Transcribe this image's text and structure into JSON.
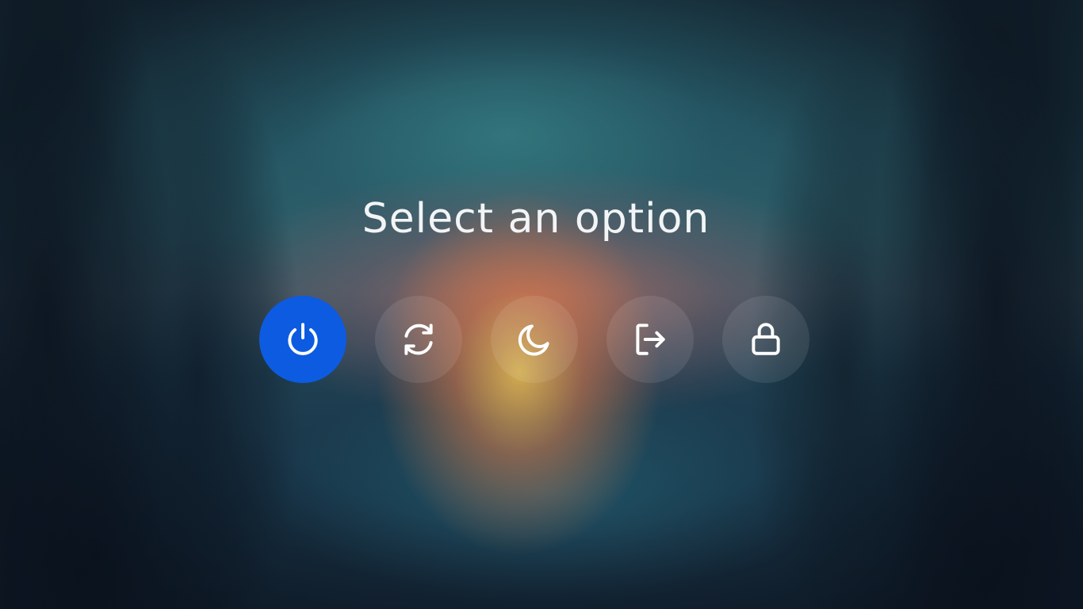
{
  "dialog": {
    "title": "Select an option",
    "accent_color": "#0d5be0"
  },
  "options": [
    {
      "id": "power",
      "icon": "power-icon",
      "selected": true
    },
    {
      "id": "restart",
      "icon": "restart-icon",
      "selected": false
    },
    {
      "id": "sleep",
      "icon": "moon-icon",
      "selected": false
    },
    {
      "id": "logout",
      "icon": "logout-icon",
      "selected": false
    },
    {
      "id": "lock",
      "icon": "lock-icon",
      "selected": false
    }
  ]
}
